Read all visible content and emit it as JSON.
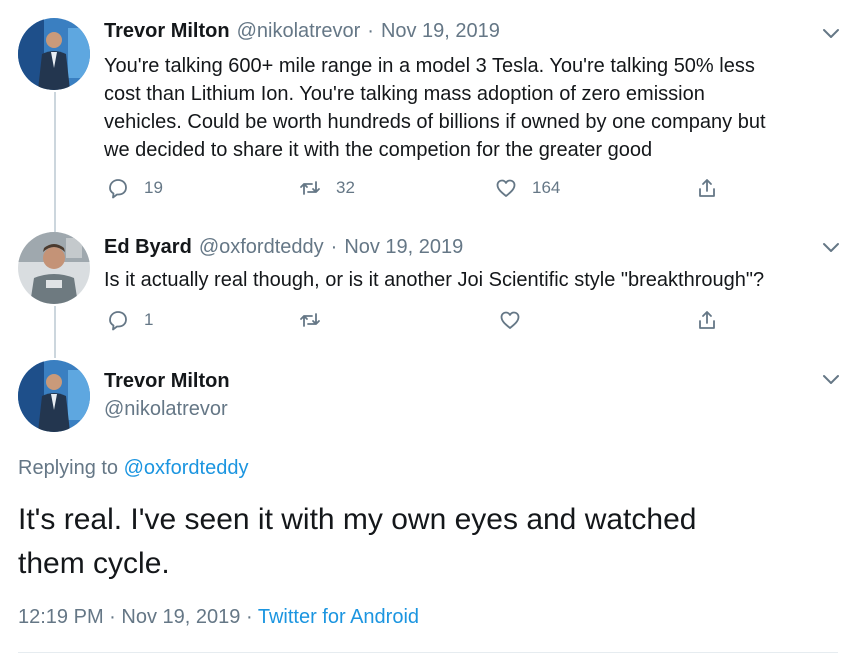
{
  "tweet1": {
    "display_name": "Trevor Milton",
    "handle": "@nikolatrevor",
    "separator": "·",
    "date": "Nov 19, 2019",
    "text_lines": [
      "You're talking 600+ mile range in a model 3 Tesla. You're talking 50% less",
      "cost than Lithium Ion. You're talking mass adoption of zero emission",
      "vehicles. Could be worth hundreds of billions if owned by one company but",
      "we decided to share it with the competion for the greater good"
    ],
    "reply_count": "19",
    "retweet_count": "32",
    "like_count": "164"
  },
  "tweet2": {
    "display_name": "Ed Byard",
    "handle": "@oxfordteddy",
    "separator": "·",
    "date": "Nov 19, 2019",
    "text": "Is it actually real though, or is it another Joi Scientific style \"breakthrough\"?",
    "reply_count": "1"
  },
  "main_tweet": {
    "display_name": "Trevor Milton",
    "handle": "@nikolatrevor",
    "replying_prefix": "Replying to",
    "replying_handle": "@oxfordteddy",
    "text_lines": [
      "It's real. I've seen it with my own eyes and watched",
      "them cycle."
    ],
    "time": "12:19 PM",
    "separator": "·",
    "date": "Nov 19, 2019",
    "source": "Twitter for Android"
  },
  "colors": {
    "text": "#14171a",
    "secondary": "#657786",
    "link": "#1b95e0",
    "thread_line": "#ccd6dd"
  },
  "icons": [
    "chevron-down-icon",
    "reply-icon",
    "retweet-icon",
    "like-icon",
    "share-icon"
  ]
}
